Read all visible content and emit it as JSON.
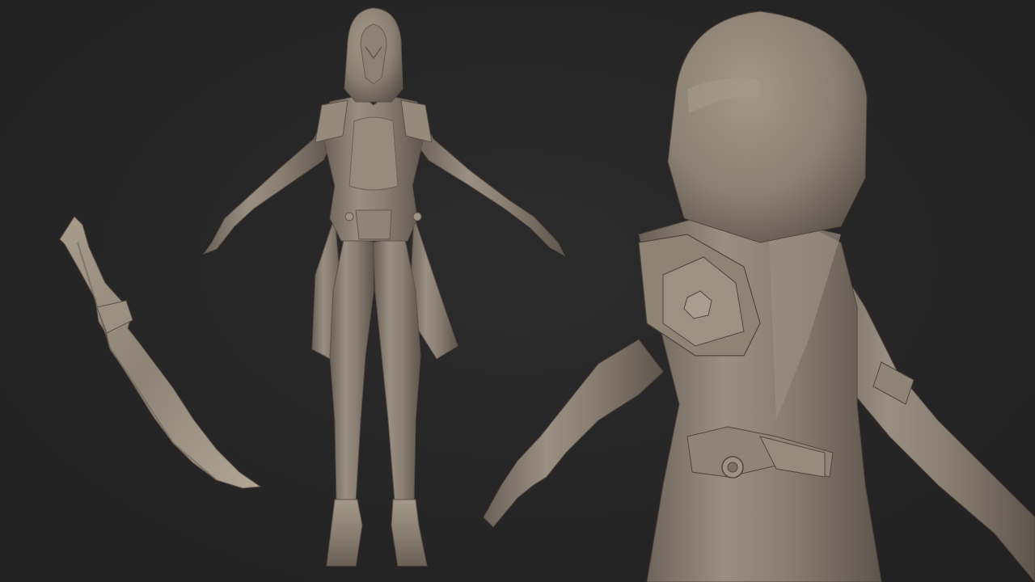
{
  "scene": {
    "background_color": "#262626",
    "clay_color": "#8a7f72",
    "clay_light": "#a59a8c",
    "clay_dark": "#5e554c",
    "objects": [
      {
        "name": "curved-blade-sculpt"
      },
      {
        "name": "hooded-character-front-sculpt"
      },
      {
        "name": "hooded-character-closeup-sculpt"
      }
    ]
  }
}
